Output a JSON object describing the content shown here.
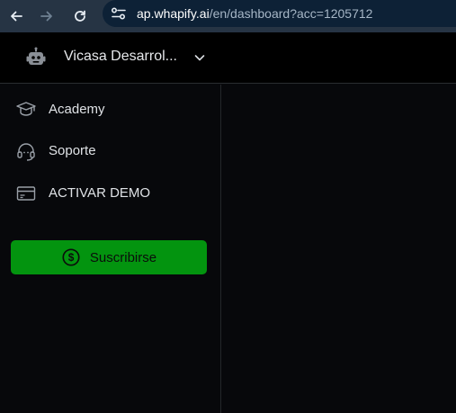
{
  "browser": {
    "url_domain": "ap.whapify.ai",
    "url_path": "/en/dashboard?acc=1205712",
    "back_icon": "arrow-left-icon",
    "forward_icon": "arrow-right-icon",
    "reload_icon": "reload-icon",
    "site_info_icon": "tune-icon"
  },
  "header": {
    "account_name": "Vicasa Desarrol...",
    "avatar_icon": "robot-icon",
    "chevron_icon": "chevron-down-icon"
  },
  "sidebar": {
    "items": [
      {
        "label": "Academy",
        "icon": "graduation-cap-icon"
      },
      {
        "label": "Soporte",
        "icon": "headset-icon"
      },
      {
        "label": "ACTIVAR DEMO",
        "icon": "credit-card-icon"
      }
    ],
    "subscribe": {
      "label": "Suscribirse",
      "icon": "dollar-circle-icon"
    }
  },
  "colors": {
    "browser_bar": "#263444",
    "omnibox": "#0d2136",
    "header_bg": "#000000",
    "page_bg": "#07080b",
    "accent_green": "#03940f"
  }
}
